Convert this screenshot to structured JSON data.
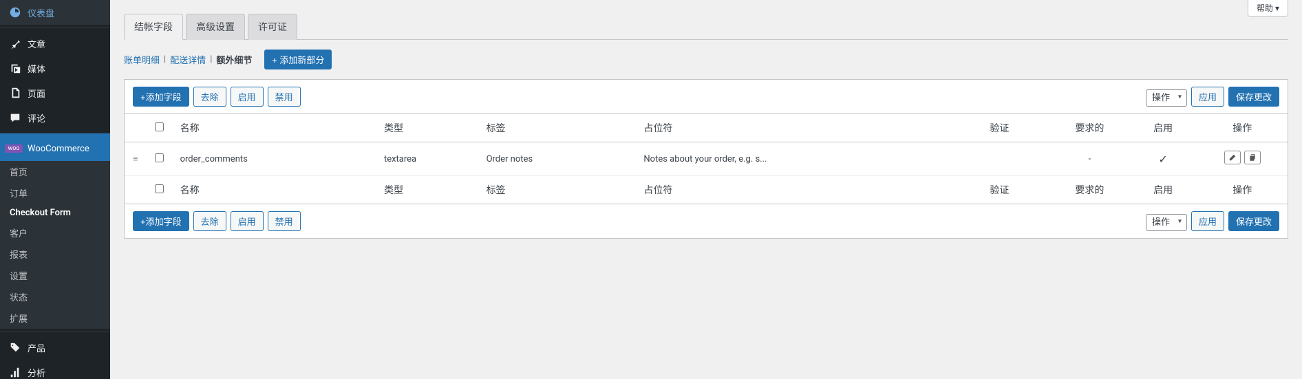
{
  "help": "帮助",
  "sidebar": {
    "dashboard": "仪表盘",
    "posts": "文章",
    "media": "媒体",
    "pages": "页面",
    "comments": "评论",
    "woocommerce": "WooCommerce",
    "submenu": {
      "home": "首页",
      "orders": "订单",
      "checkout_form": "Checkout Form",
      "customers": "客户",
      "reports": "报表",
      "settings": "设置",
      "status": "状态",
      "extensions": "扩展"
    },
    "products": "产品",
    "analytics": "分析"
  },
  "tabs": {
    "checkout_fields": "结帐字段",
    "advanced": "高级设置",
    "license": "许可证"
  },
  "subnav": {
    "billing": "账单明细",
    "shipping": "配送详情",
    "additional": "额外细节",
    "add_section": "+ 添加新部分"
  },
  "toolbar": {
    "add_field": "+添加字段",
    "remove": "去除",
    "enable": "启用",
    "disable": "禁用",
    "bulk_action": "操作",
    "apply": "应用",
    "save": "保存更改"
  },
  "columns": {
    "name": "名称",
    "type": "类型",
    "label": "标签",
    "placeholder": "占位符",
    "validate": "验证",
    "required": "要求的",
    "enabled": "启用",
    "actions": "操作"
  },
  "rows": [
    {
      "name": "order_comments",
      "type": "textarea",
      "label": "Order notes",
      "placeholder": "Notes about your order, e.g. s...",
      "required": "-",
      "enabled": "✓"
    }
  ]
}
